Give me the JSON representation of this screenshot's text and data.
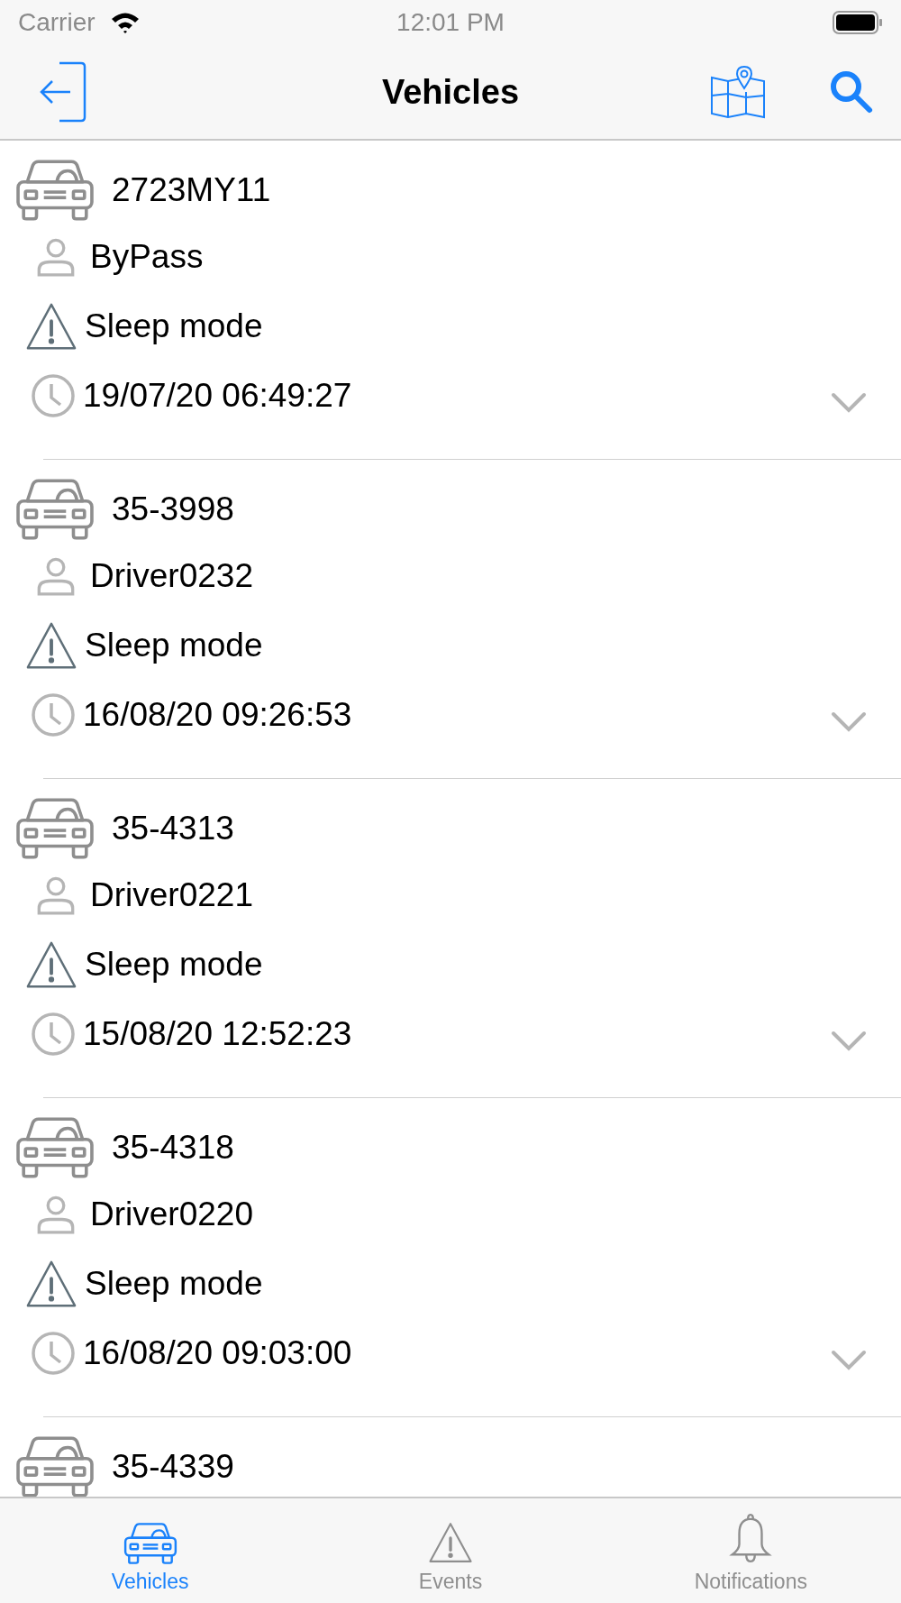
{
  "status_bar": {
    "carrier": "Carrier",
    "time": "12:01 PM"
  },
  "nav_bar": {
    "title": "Vehicles"
  },
  "vehicles": [
    {
      "plate": "2723MY11",
      "driver": "ByPass",
      "status": "Sleep mode",
      "timestamp": "19/07/20 06:49:27",
      "expanded": false
    },
    {
      "plate": "35-3998",
      "driver": "Driver0232",
      "status": "Sleep mode",
      "timestamp": "16/08/20 09:26:53",
      "expanded": false
    },
    {
      "plate": "35-4313",
      "driver": "Driver0221",
      "status": "Sleep mode",
      "timestamp": "15/08/20 12:52:23",
      "expanded": false
    },
    {
      "plate": "35-4318",
      "driver": "Driver0220",
      "status": "Sleep mode",
      "timestamp": "16/08/20 09:03:00",
      "expanded": false
    },
    {
      "plate": "35-4339"
    }
  ],
  "tab_bar": [
    {
      "kind": "vehicles",
      "label": "Vehicles",
      "selected": true
    },
    {
      "kind": "events",
      "label": "Events",
      "selected": false
    },
    {
      "kind": "notifications",
      "label": "Notifications",
      "selected": false
    }
  ]
}
